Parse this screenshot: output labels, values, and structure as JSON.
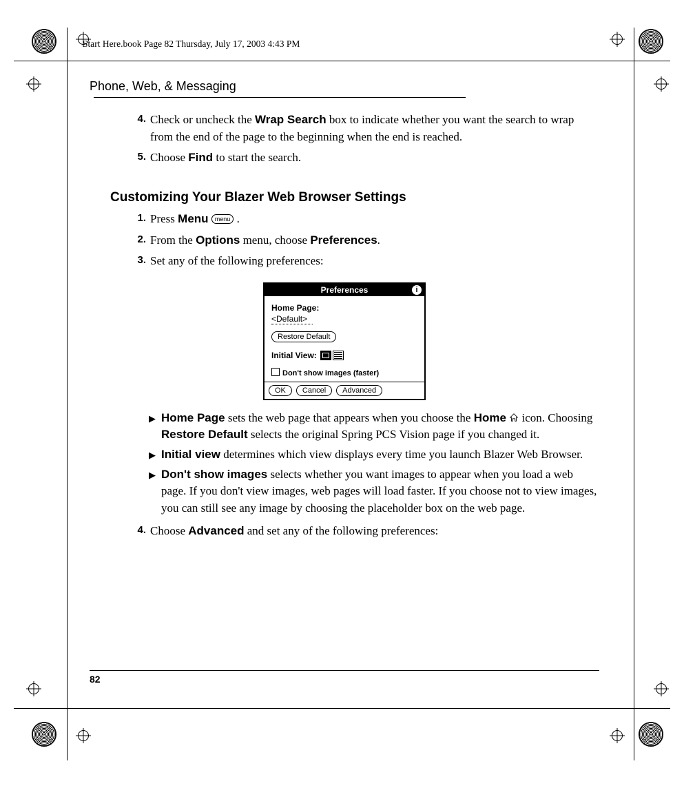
{
  "header": "Start Here.book  Page 82  Thursday, July 17, 2003  4:43 PM",
  "section_title": "Phone, Web, & Messaging",
  "page_number": "82",
  "steps_a": [
    {
      "n": "4.",
      "pre": "Check or uncheck the ",
      "bold": "Wrap Search",
      "post": " box to indicate whether you want the search to wrap from the end of the page to the beginning when the end is reached."
    },
    {
      "n": "5.",
      "pre": "Choose ",
      "bold": "Find",
      "post": " to start the search."
    }
  ],
  "subheading": "Customizing Your Blazer Web Browser Settings",
  "steps_b": [
    {
      "n": "1.",
      "pre": "Press ",
      "bold": "Menu",
      "key": "menu",
      "post": " ."
    },
    {
      "n": "2.",
      "pre": "From the ",
      "bold": "Options",
      "mid": " menu, choose ",
      "bold2": "Preferences",
      "post": "."
    },
    {
      "n": "3.",
      "pre": "Set any of the following preferences:",
      "bold": "",
      "post": ""
    }
  ],
  "dialog": {
    "title": "Preferences",
    "home_label": "Home Page:",
    "home_value": "<Default>",
    "restore": "Restore Default",
    "initial_view": "Initial View:",
    "dont_show": "Don't show images (faster)",
    "ok": "OK",
    "cancel": "Cancel",
    "advanced": "Advanced"
  },
  "bullets": [
    {
      "bold": "Home Page",
      "pre": " sets the web page that appears when you choose the ",
      "bold2": "Home",
      "home_icon": true,
      "post": " icon. Choosing ",
      "bold3": "Restore Default",
      "tail": " selects the original Spring PCS Vision page if you changed it."
    },
    {
      "bold": "Initial view",
      "pre": " determines which view displays every time you launch Blazer Web Browser.",
      "post": ""
    },
    {
      "bold": "Don't show images",
      "pre": " selects whether you want images to appear when you load a web page. If you don't view images, web pages will load faster. If you choose not to view images, you can still see any image by choosing the placeholder box on the web page.",
      "post": ""
    }
  ],
  "step_4": {
    "n": "4.",
    "pre": "Choose ",
    "bold": "Advanced",
    "post": " and set any of the following preferences:"
  }
}
